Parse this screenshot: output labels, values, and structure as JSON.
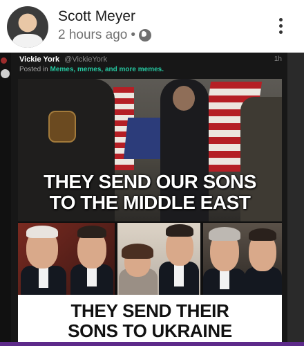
{
  "post": {
    "author": "Scott Meyer",
    "timestamp": "2 hours ago",
    "separator": "•"
  },
  "embed": {
    "name": "Vickie York",
    "handle": "@VickieYork",
    "time": "1h",
    "posted_in_prefix": "Posted in ",
    "group": "Memes, memes, and more memes."
  },
  "meme": {
    "top_caption_line1": "THEY SEND OUR SONS",
    "top_caption_line2": "TO THE MIDDLE EAST",
    "bottom_caption_line1": "THEY SEND THEIR",
    "bottom_caption_line2": "SONS TO UKRAINE"
  },
  "icons": {
    "privacy": "globe-icon",
    "menu": "more-vertical-icon"
  },
  "colors": {
    "group_link": "#25c7a0",
    "bottom_bar": "#5d2a8a"
  }
}
